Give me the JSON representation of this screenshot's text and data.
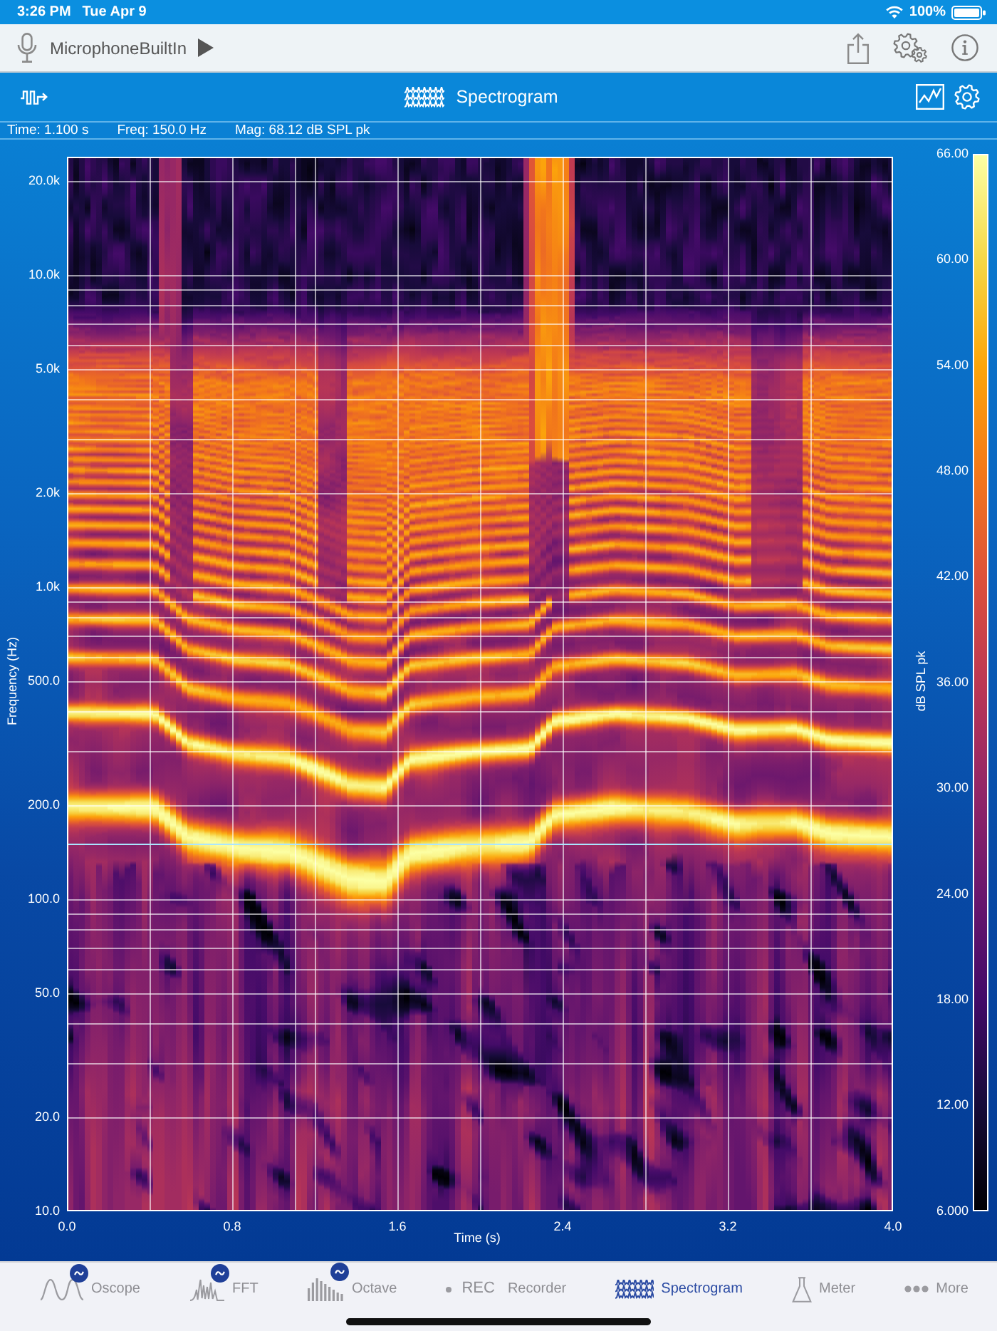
{
  "status_bar": {
    "time": "3:26 PM",
    "date": "Tue Apr 9",
    "battery": "100%"
  },
  "toolbar": {
    "input_device": "MicrophoneBuiltIn"
  },
  "header": {
    "title": "Spectrogram"
  },
  "readout": [
    "Time: 1.100 s",
    "Freq: 150.0 Hz",
    "Mag: 68.12 dB SPL pk"
  ],
  "plot": {
    "ylabel": "Frequency (Hz)",
    "yticks": [
      "20.0k",
      "10.0k",
      "5.0k",
      "2.0k",
      "1.0k",
      "500.0",
      "200.0",
      "100.0",
      "50.0",
      "20.0",
      "10.0"
    ],
    "xlabel": "Time (s)",
    "xticks": [
      "0.0",
      "0.8",
      "1.6",
      "2.4",
      "3.2",
      "4.0"
    ],
    "colorbar": {
      "label": "dB SPL pk",
      "ticks": [
        "66.00",
        "60.00",
        "54.00",
        "48.00",
        "42.00",
        "36.00",
        "30.00",
        "24.00",
        "18.00",
        "12.00",
        "6.000"
      ]
    }
  },
  "tabs": [
    {
      "kind": "oscope",
      "label": "Oscope",
      "badge": true,
      "selected": false
    },
    {
      "kind": "fft",
      "label": "FFT",
      "badge": true,
      "selected": false
    },
    {
      "kind": "octave",
      "label": "Octave",
      "badge": true,
      "selected": false
    },
    {
      "kind": "recorder",
      "icon_text": "REC",
      "label": "Recorder",
      "badge": false,
      "selected": false
    },
    {
      "kind": "spectrogram",
      "label": "Spectrogram",
      "badge": false,
      "selected": true
    },
    {
      "kind": "meter",
      "label": "Meter",
      "badge": false,
      "selected": false
    },
    {
      "kind": "more",
      "label": "More",
      "badge": false,
      "selected": false
    }
  ]
}
